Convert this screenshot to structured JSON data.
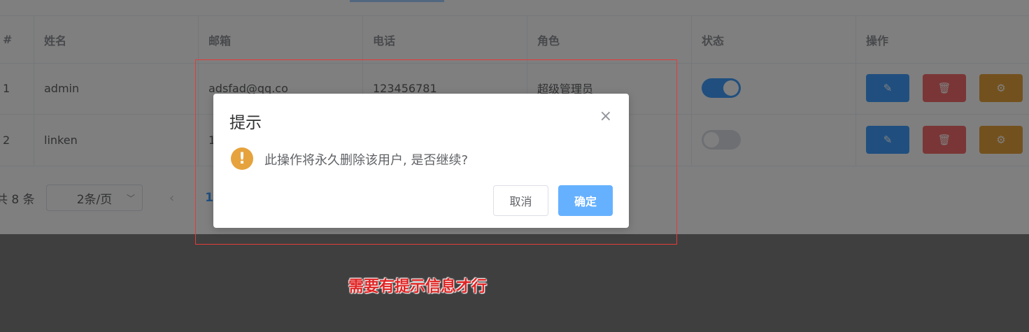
{
  "table": {
    "headers": [
      "#",
      "姓名",
      "邮箱",
      "电话",
      "角色",
      "状态",
      "操作"
    ],
    "rows": [
      {
        "index": "1",
        "name": "admin",
        "email": "adsfad@qq.co",
        "phone": "123456781",
        "role": "超级管理员",
        "status_on": true
      },
      {
        "index": "2",
        "name": "linken",
        "email": "1",
        "phone": "",
        "role": "",
        "status_on": false
      }
    ],
    "actions": {
      "edit_icon": "edit-icon",
      "delete_icon": "delete-icon",
      "setting_icon": "setting-icon"
    }
  },
  "pagination": {
    "total": "共 8 条",
    "page_size": "2条/页",
    "prev": "‹",
    "current_page": "1"
  },
  "dialog": {
    "title": "提示",
    "close": "×",
    "message": "此操作将永久删除该用户, 是否继续?",
    "warning_icon": "!",
    "cancel": "取消",
    "confirm": "确定"
  },
  "annotation": {
    "note": "需要有提示信息才行"
  },
  "colors": {
    "primary": "#409eff",
    "danger": "#f56c6c",
    "warning": "#e6a23c",
    "annotation": "#e02424"
  }
}
